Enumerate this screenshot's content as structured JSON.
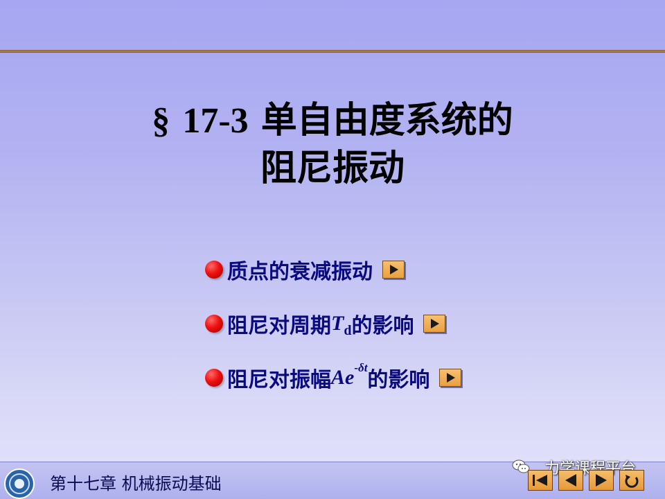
{
  "slide": {
    "title_line1_section": "§",
    "title_line1_number": "17-3",
    "title_line1_text": "单自由度系统的",
    "title_line2": "阻尼振动"
  },
  "menu": {
    "items": [
      {
        "text": "质点的衰减振动"
      },
      {
        "text_before": "阻尼对周期",
        "math": "T",
        "subscript": "d",
        "text_after": "的影响"
      },
      {
        "text_before": "阻尼对振幅",
        "math": "Ae",
        "superscript": "-δt",
        "text_after": "的影响"
      }
    ]
  },
  "footer": {
    "chapter_text": "第十七章  机械振动基础",
    "watermark": "力学课程平台"
  },
  "colors": {
    "background_top": "#a6a6f2",
    "background_bottom": "#e2e2fa",
    "menu_text": "#0a0a80",
    "bullet": "#ee1010",
    "button": "#e9a040",
    "top_rule": "#a07040"
  },
  "icons": {
    "bullet": "red-circle-bullet",
    "link": "play-triangle-icon",
    "nav_first": "first-slide-icon",
    "nav_prev": "previous-slide-icon",
    "nav_next": "next-slide-icon",
    "nav_return": "return-icon",
    "watermark": "wechat-icon"
  }
}
